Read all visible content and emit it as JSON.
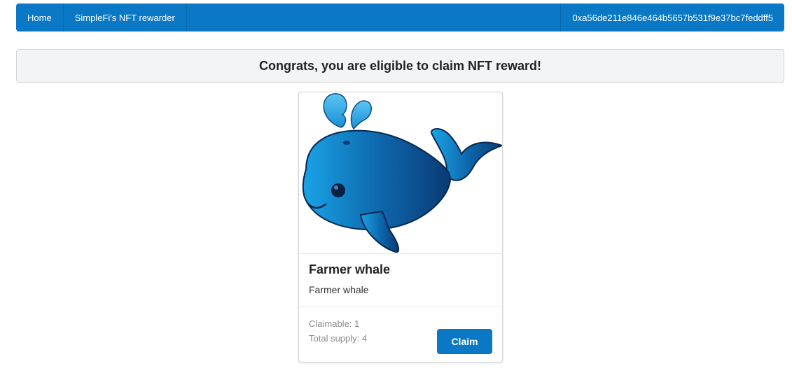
{
  "nav": {
    "home_label": "Home",
    "app_label": "SimpleFi's NFT rewarder",
    "wallet_address": "0xa56de211e846e464b5657b531f9e37bc7feddff5"
  },
  "banner": {
    "message": "Congrats, you are eligible to claim NFT reward!"
  },
  "card": {
    "image_icon": "whale-illustration",
    "title": "Farmer whale",
    "description": "Farmer whale",
    "claimable": "Claimable: 1",
    "total_supply": "Total supply: 4",
    "claim_label": "Claim"
  },
  "colors": {
    "accent": "#0a78c4",
    "whale_light": "#1a9fe0",
    "whale_dark": "#0a3d78",
    "banner_bg": "#f3f4f5"
  }
}
